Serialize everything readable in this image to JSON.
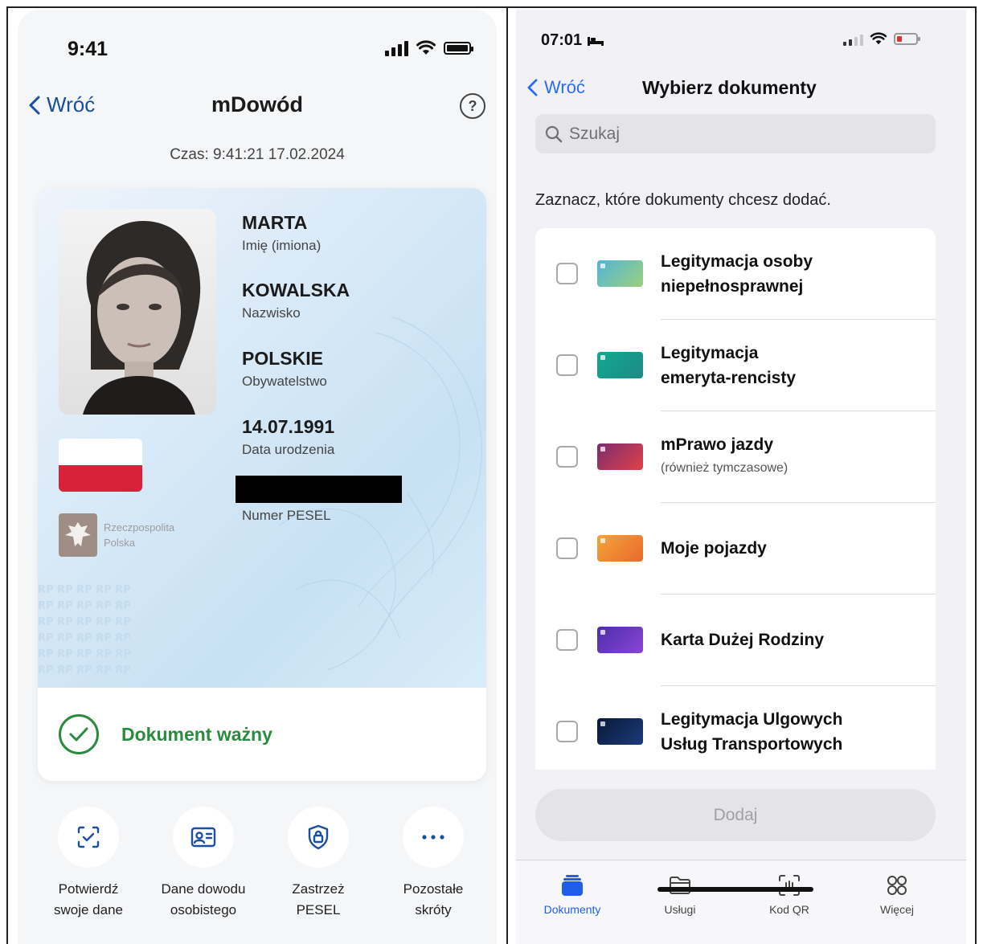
{
  "left": {
    "status": {
      "time": "9:41"
    },
    "nav": {
      "back_label": "Wróć",
      "title": "mDowód",
      "help_symbol": "?"
    },
    "time_line": "Czas: 9:41:21 17.02.2024",
    "card": {
      "first_name": {
        "value": "MARTA",
        "label": "Imię (imiona)"
      },
      "last_name": {
        "value": "KOWALSKA",
        "label": "Nazwisko"
      },
      "citizenship": {
        "value": "POLSKIE",
        "label": "Obywatelstwo"
      },
      "birth_date": {
        "value": "14.07.1991",
        "label": "Data urodzenia"
      },
      "pesel": {
        "label": "Numer PESEL"
      },
      "emblem_text_1": "Rzeczpospolita",
      "emblem_text_2": "Polska",
      "pattern_text": "RP RP RP RP RP"
    },
    "validity": {
      "text": "Dokument ważny",
      "color": "#2a8a3e"
    },
    "shortcuts": [
      {
        "line1": "Potwierdź",
        "line2": "swoje dane",
        "icon": "scan-check-icon"
      },
      {
        "line1": "Dane dowodu",
        "line2": "osobistego",
        "icon": "id-card-icon"
      },
      {
        "line1": "Zastrzeż",
        "line2": "PESEL",
        "icon": "shield-lock-icon"
      },
      {
        "line1": "Pozostałe",
        "line2": "skróty",
        "icon": "more-dots-icon"
      }
    ]
  },
  "right": {
    "status": {
      "time": "07:01"
    },
    "nav": {
      "back_label": "Wróć",
      "title": "Wybierz dokumenty"
    },
    "search": {
      "placeholder": "Szukaj"
    },
    "instruction": "Zaznacz, które dokumenty chcesz dodać.",
    "documents": [
      {
        "line1": "Legitymacja osoby",
        "line2": "niepełnosprawnej",
        "color": "#6cc0c9"
      },
      {
        "line1": "Legitymacja",
        "line2": "emeryta-rencisty",
        "color": "#17998a"
      },
      {
        "line1": "mPrawo jazdy",
        "sub": "(również tymczasowe)",
        "color": "#b8324f"
      },
      {
        "line1": "Moje pojazdy",
        "color": "#ef8a2a"
      },
      {
        "line1": "Karta Dużej Rodziny",
        "color": "#6b3cc9"
      },
      {
        "line1": "Legitymacja Ulgowych",
        "line2": "Usług Transportowych",
        "color": "#0f1f4a"
      }
    ],
    "add_button": "Dodaj",
    "tabs": [
      {
        "label": "Dokumenty",
        "icon": "documents-stack-icon",
        "active": true
      },
      {
        "label": "Usługi",
        "icon": "folder-icon"
      },
      {
        "label": "Kod QR",
        "icon": "qr-scan-icon"
      },
      {
        "label": "Więcej",
        "icon": "grid-more-icon"
      }
    ],
    "accent": "#1f5fe8"
  }
}
